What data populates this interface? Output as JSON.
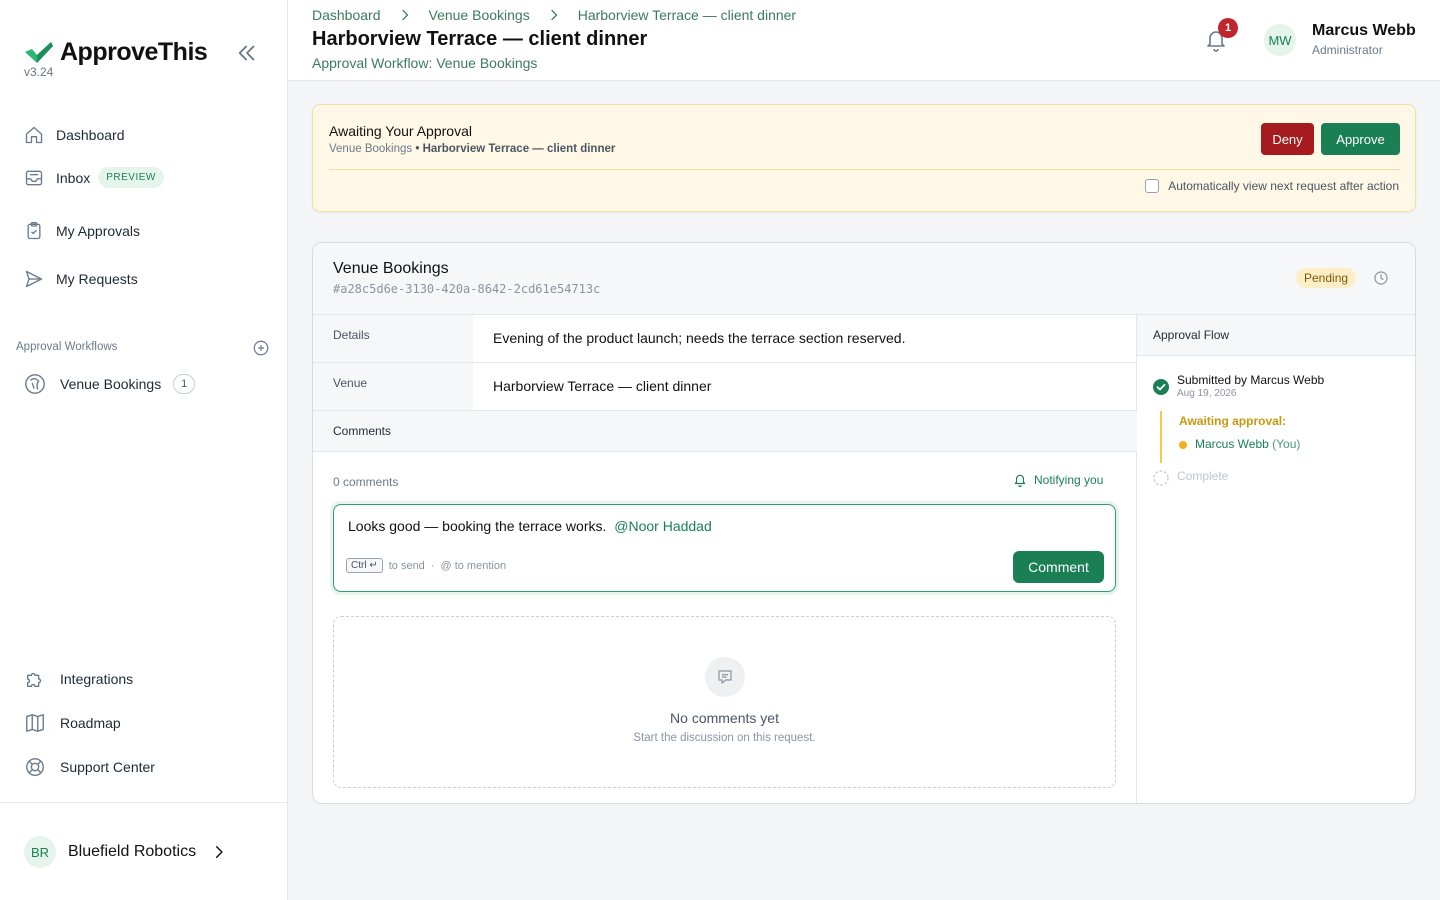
{
  "app": {
    "name": "ApproveThis",
    "version": "v3.24"
  },
  "sidebar": {
    "nav": [
      {
        "label": "Dashboard",
        "icon": "home-icon"
      },
      {
        "label": "Inbox",
        "icon": "inbox-icon",
        "badge": "PREVIEW"
      },
      {
        "label": "My Approvals",
        "icon": "clipboard-check-icon"
      },
      {
        "label": "My Requests",
        "icon": "send-icon"
      }
    ],
    "workflows_label": "Approval Workflows",
    "workflows": [
      {
        "label": "Venue Bookings",
        "count": "1",
        "icon": "venue-icon"
      }
    ],
    "bottom": [
      {
        "label": "Integrations",
        "icon": "puzzle-icon"
      },
      {
        "label": "Roadmap",
        "icon": "map-icon"
      },
      {
        "label": "Support Center",
        "icon": "lifebuoy-icon"
      }
    ],
    "org": {
      "initials": "BR",
      "name": "Bluefield Robotics"
    }
  },
  "header": {
    "breadcrumb": [
      "Dashboard",
      "Venue Bookings",
      "Harborview Terrace — client dinner"
    ],
    "title": "Harborview Terrace — client dinner",
    "subtitle": "Approval Workflow: Venue Bookings",
    "notifications": "1",
    "user": {
      "initials": "MW",
      "name": "Marcus Webb",
      "role": "Administrator"
    }
  },
  "banner": {
    "title": "Awaiting Your Approval",
    "sub_workflow": "Venue Bookings",
    "sub_bullet": "•",
    "sub_request": "Harborview Terrace — client dinner",
    "deny": "Deny",
    "approve": "Approve",
    "auto_next": "Automatically view next request after action"
  },
  "request": {
    "workflow": "Venue Bookings",
    "id": "#a28c5d6e-3130-420a-8642-2cd61e54713c",
    "status": "Pending",
    "fields": [
      {
        "label": "Details",
        "value": "Evening of the product launch; needs the terrace section reserved."
      },
      {
        "label": "Venue",
        "value": "Harborview Terrace — client dinner"
      }
    ]
  },
  "comments": {
    "heading": "Comments",
    "count": "0 comments",
    "notifying": "Notifying you",
    "draft_text": "Looks good — booking the terrace works.",
    "draft_mention": "@Noor Haddad",
    "hint_key": "Ctrl ↵",
    "hint_send": "to send",
    "hint_dot": "·",
    "hint_mention": "@ to mention",
    "button": "Comment",
    "empty_title": "No comments yet",
    "empty_sub": "Start the discussion on this request."
  },
  "flow": {
    "heading": "Approval Flow",
    "submitted": "Submitted by Marcus Webb",
    "date": "Aug 19, 2026",
    "awaiting": "Awaiting approval:",
    "approver": "Marcus Webb",
    "approver_you": "(You)",
    "complete": "Complete"
  },
  "colors": {
    "brand": "#1a7f55",
    "deny": "#a61b1f",
    "pending_bg": "#fcefc7",
    "banner_bg": "#fff8e6",
    "awaiting": "#c9980d"
  }
}
